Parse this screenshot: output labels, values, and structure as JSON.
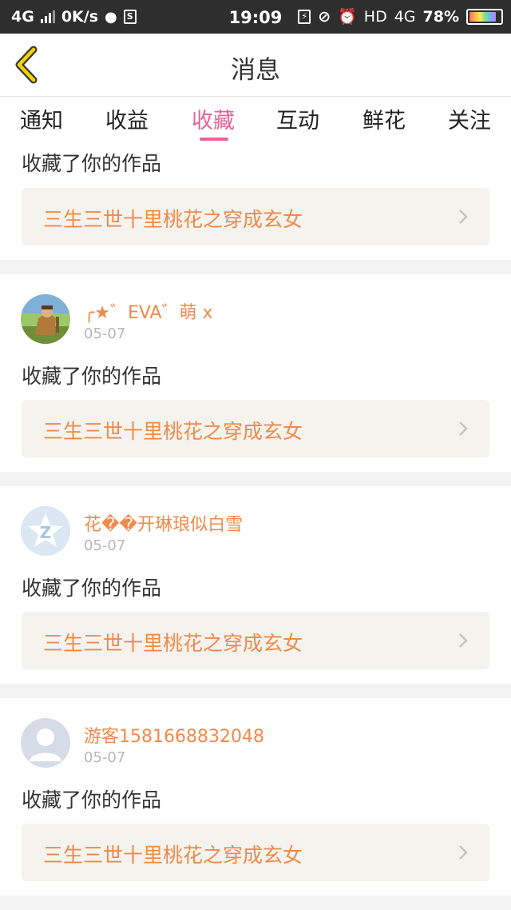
{
  "status_bar": {
    "network_left": "4G",
    "speed": "0K/s",
    "time": "19:09",
    "hd": "HD",
    "network_right": "4G",
    "battery": "78%"
  },
  "header": {
    "title": "消息"
  },
  "tabs": [
    {
      "label": "通知"
    },
    {
      "label": "收益"
    },
    {
      "label": "收藏",
      "active": true
    },
    {
      "label": "互动"
    },
    {
      "label": "鲜花"
    },
    {
      "label": "关注"
    }
  ],
  "colors": {
    "accent": "#e7649a",
    "name": "#f08a4b",
    "work_bg": "#f4f3ee"
  },
  "items": [
    {
      "action": "收藏了你的作品",
      "work": "三生三世十里桃花之穿成玄女"
    },
    {
      "user": "╭★゛EVA゛萌 x",
      "date": "05-07",
      "avatar": "game-character",
      "action": "收藏了你的作品",
      "work": "三生三世十里桃花之穿成玄女"
    },
    {
      "user": "花��开琳琅似白雪",
      "date": "05-07",
      "avatar": "qq-logo",
      "action": "收藏了你的作品",
      "work": "三生三世十里桃花之穿成玄女"
    },
    {
      "user": "游客1581668832048",
      "date": "05-07",
      "avatar": "default-person",
      "action": "收藏了你的作品",
      "work": "三生三世十里桃花之穿成玄女"
    }
  ]
}
